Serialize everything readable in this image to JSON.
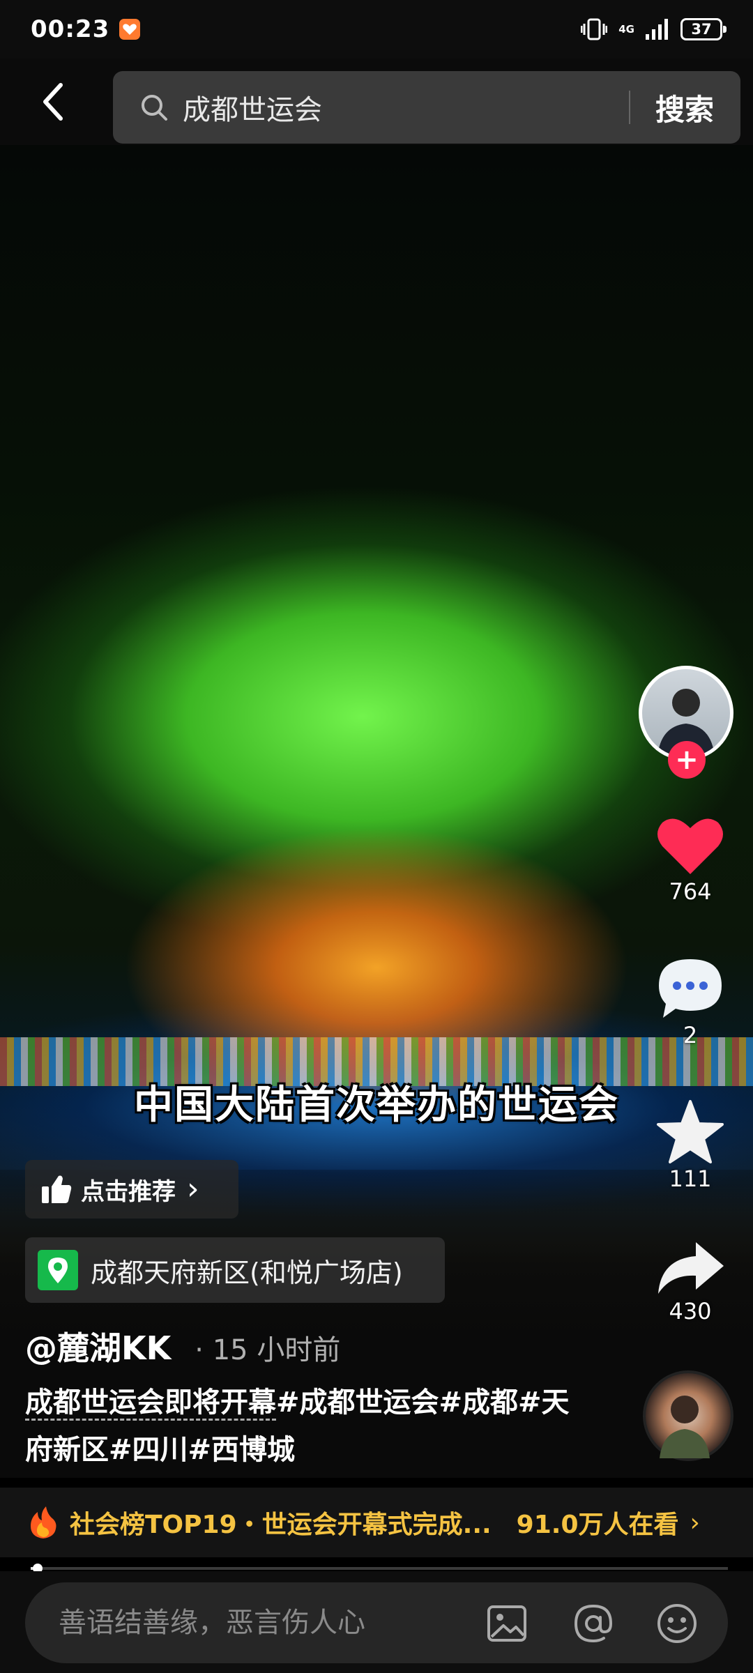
{
  "status_bar": {
    "time": "00:23",
    "network": "4G",
    "battery": "37"
  },
  "search": {
    "query": "成都世运会",
    "button_label": "搜索"
  },
  "video": {
    "caption": "中国大陆首次举办的世运会"
  },
  "actions": {
    "likes": "764",
    "comments": "2",
    "favorites": "111",
    "shares": "430",
    "follow_symbol": "+"
  },
  "recommend": {
    "label": "点击推荐",
    "chevron": "›"
  },
  "location": {
    "label": "成都天府新区(和悦广场店)"
  },
  "post": {
    "author": "@麓湖KK",
    "time": "· 15 小时前",
    "title": "成都世运会即将开幕",
    "hashtags": [
      "#成都世运会",
      "#成都",
      "#天府新区",
      "#四川",
      "#西博城"
    ]
  },
  "hot": {
    "text": "社会榜TOP19・世运会开幕式完成...",
    "viewers": "91.0万人在看",
    "chevron": "›"
  },
  "playback": {
    "progress": 0.01
  },
  "comment": {
    "placeholder": "善语结善缘，恶言伤人心"
  },
  "colors": {
    "accent": "#fe2c55",
    "hot": "#f5c342",
    "location_badge": "#16b94b"
  },
  "icons": [
    "back-icon",
    "search-icon",
    "heart-icon",
    "comment-icon",
    "star-icon",
    "share-icon",
    "thumbs-up-icon",
    "location-pin-icon",
    "fire-icon",
    "image-icon",
    "at-icon",
    "emoji-icon"
  ]
}
